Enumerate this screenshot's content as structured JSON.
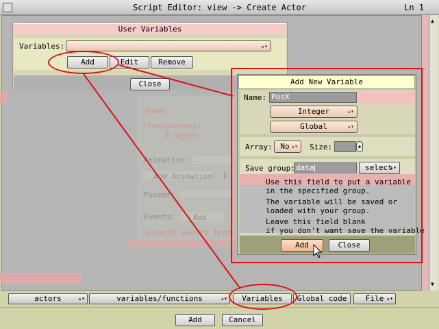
{
  "window": {
    "title": "Script Editor: view -> Create Actor",
    "line_indicator": "Ln 1"
  },
  "user_variables": {
    "title": "User Variables",
    "variables_label": "Variables:",
    "variables_value": "",
    "add_label": "Add",
    "edit_label": "Edit",
    "remove_label": "Remove",
    "close_label": "Close"
  },
  "background_form": {
    "name_label": "Name:",
    "transparency_label": "Transparency:",
    "zdepth_label": "Z Depth:",
    "animation_label": "Animation:",
    "add_animation_label": "Add Animation",
    "f_label": "F",
    "parent_label": "Parent:",
    "events_label": "Events:",
    "events_add_label": "Add",
    "inherit_label": "Inherit events from:"
  },
  "add_new_variable": {
    "title": "Add New Variable",
    "name_label": "Name:",
    "name_value": "PosX",
    "type_value": "Integer",
    "scope_value": "Global",
    "array_label": "Array:",
    "array_value": "No",
    "size_label": "Size:",
    "size_value": "",
    "save_group_label": "Save group:",
    "save_group_value": "data",
    "select_label": "select",
    "help_lines": [
      "Use this field to put a variable",
      "in the specified group.",
      "The variable will be saved or",
      "loaded with your group.",
      "Leave this field blank",
      "if you don't want save the variable"
    ],
    "add_label": "Add",
    "close_label": "Close"
  },
  "bottom_tabs": {
    "actors": "actors",
    "variables_functions": "variables/functions",
    "variables": "Variables",
    "global_code": "Global code",
    "file": "File"
  },
  "footer": {
    "add_label": "Add",
    "cancel_label": "Cancel"
  },
  "colors": {
    "window_bg": "#d3d3a9",
    "title_pink": "#f5c8c8",
    "annotation_red": "#e01010",
    "dialog_bg": "#b7b7a0"
  }
}
